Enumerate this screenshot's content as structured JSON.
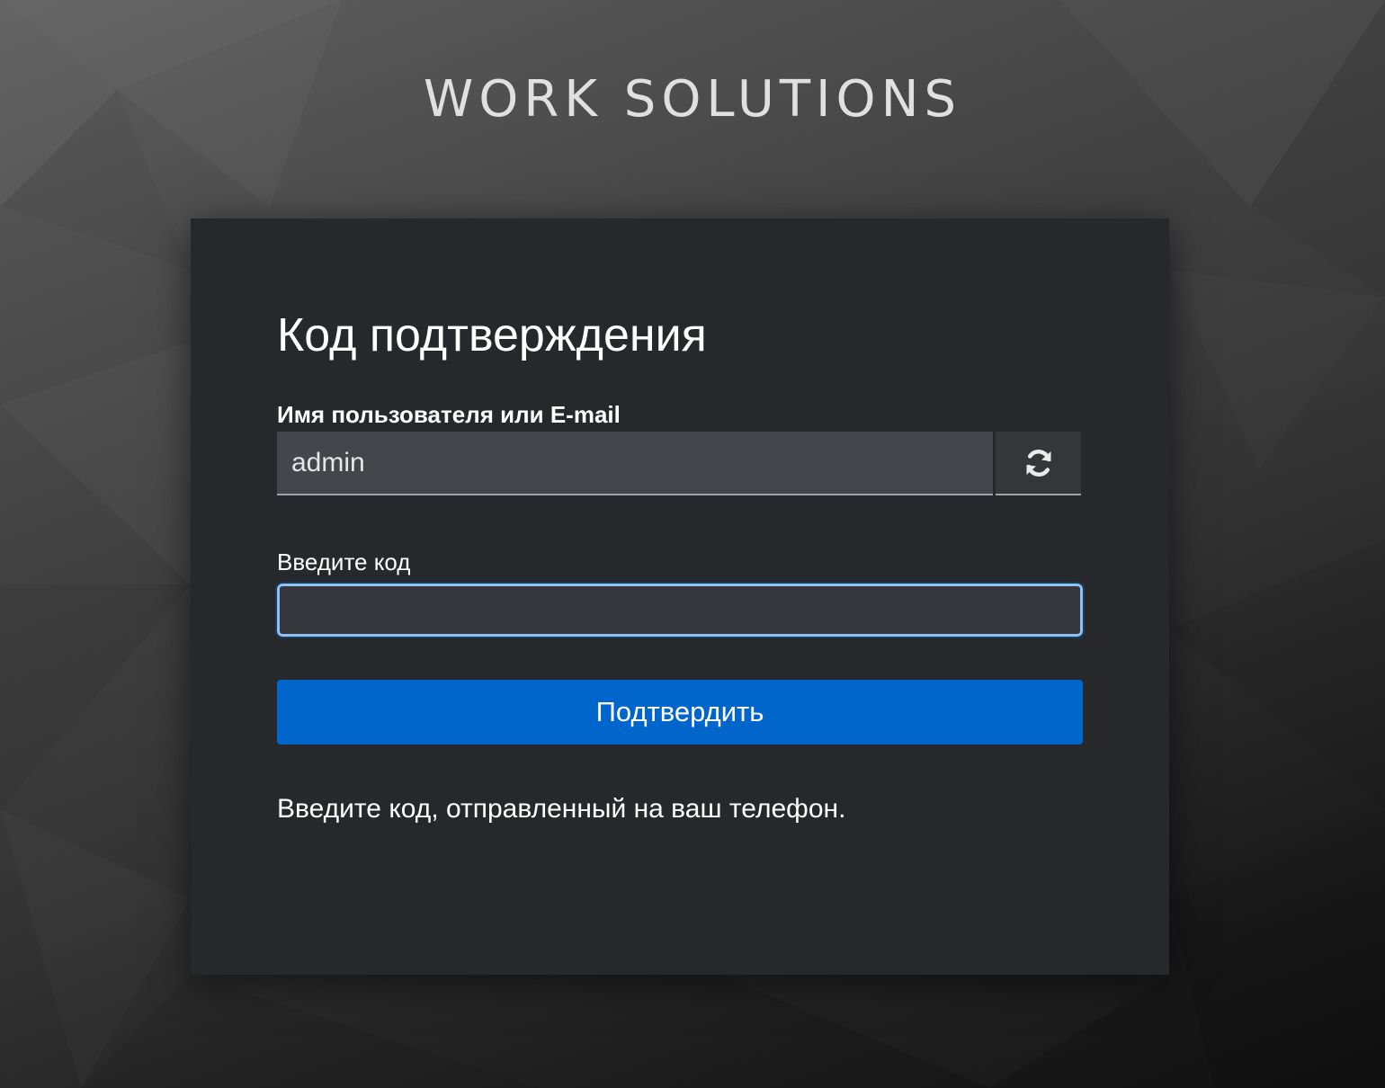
{
  "brand": {
    "title": "WORK SOLUTIONS"
  },
  "form": {
    "title": "Код подтверждения",
    "username_label": "Имя пользователя или E-mail",
    "username_value": "admin",
    "reset_icon": "refresh-icon",
    "code_label": "Введите код",
    "code_value": "",
    "submit_label": "Подтвердить",
    "info": "Введите код, отправленный на ваш телефон."
  },
  "colors": {
    "accent": "#0066cc",
    "focus_border": "#8fc1f3",
    "card_background": "#27282c"
  }
}
